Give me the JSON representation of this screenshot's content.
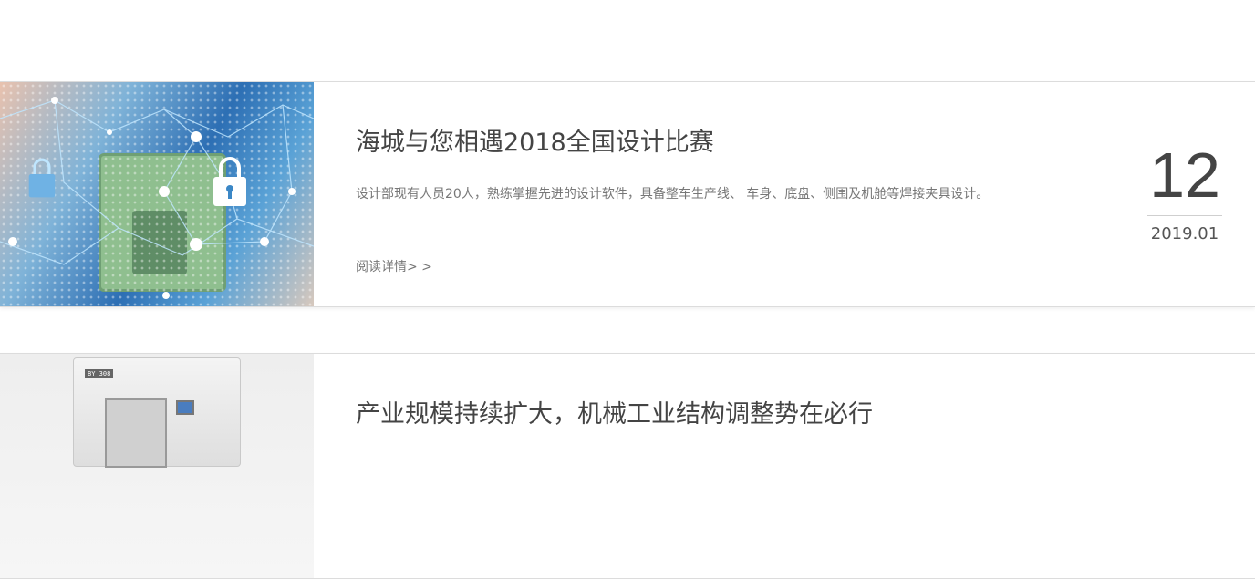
{
  "articles": [
    {
      "title": "海城与您相遇2018全国设计比赛",
      "description": "设计部现有人员20人，熟练掌握先进的设计软件，具备整车生产线、 车身、底盘、侧围及机舱等焊接夹具设计。",
      "read_more": "阅读详情> >",
      "day": "12",
      "year_month": "2019.01",
      "image_icon": "cyber-security-lock-image"
    },
    {
      "title": "产业规模持续扩大，机械工业结构调整势在必行",
      "image_icon": "machine-tool-image",
      "machine_label": "BY 308"
    }
  ],
  "colors": {
    "title": "#444444",
    "body_text": "#777777",
    "border": "#dcdcdc",
    "accent_blue": "#2d6fb4"
  }
}
